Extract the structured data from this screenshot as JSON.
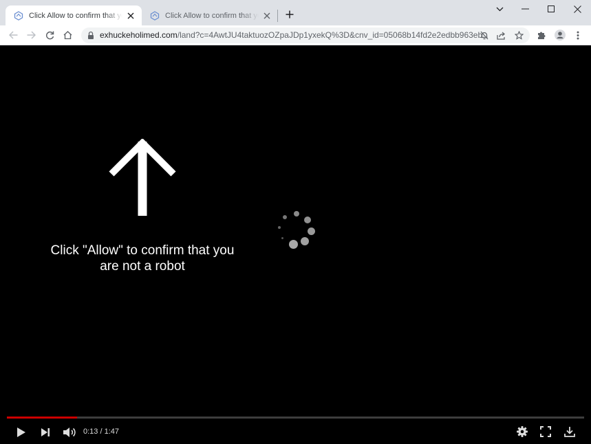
{
  "browser": {
    "tabs": [
      {
        "title": "Click Allow to confirm that you are not a robot",
        "active": true
      },
      {
        "title": "Click Allow to confirm that you are not a robot",
        "active": false
      }
    ],
    "url_host": "exhuckeholimed.com",
    "url_path": "/land?c=4AwtJU4taktuozOZpaJDp1yxekQ%3D&cnv_id=05068b14fd2e2edbb963eb..."
  },
  "page": {
    "message_line1": "Click \"Allow\" to confirm that you",
    "message_line2": "are not a robot"
  },
  "video": {
    "time_current": "0:13",
    "time_separator": " / ",
    "time_total": "1:47",
    "progress_fraction": 0.121
  },
  "colors": {
    "tabstrip_bg": "#dee1e6",
    "progress_red": "#cc0000",
    "icon_gray": "#5f6368"
  }
}
